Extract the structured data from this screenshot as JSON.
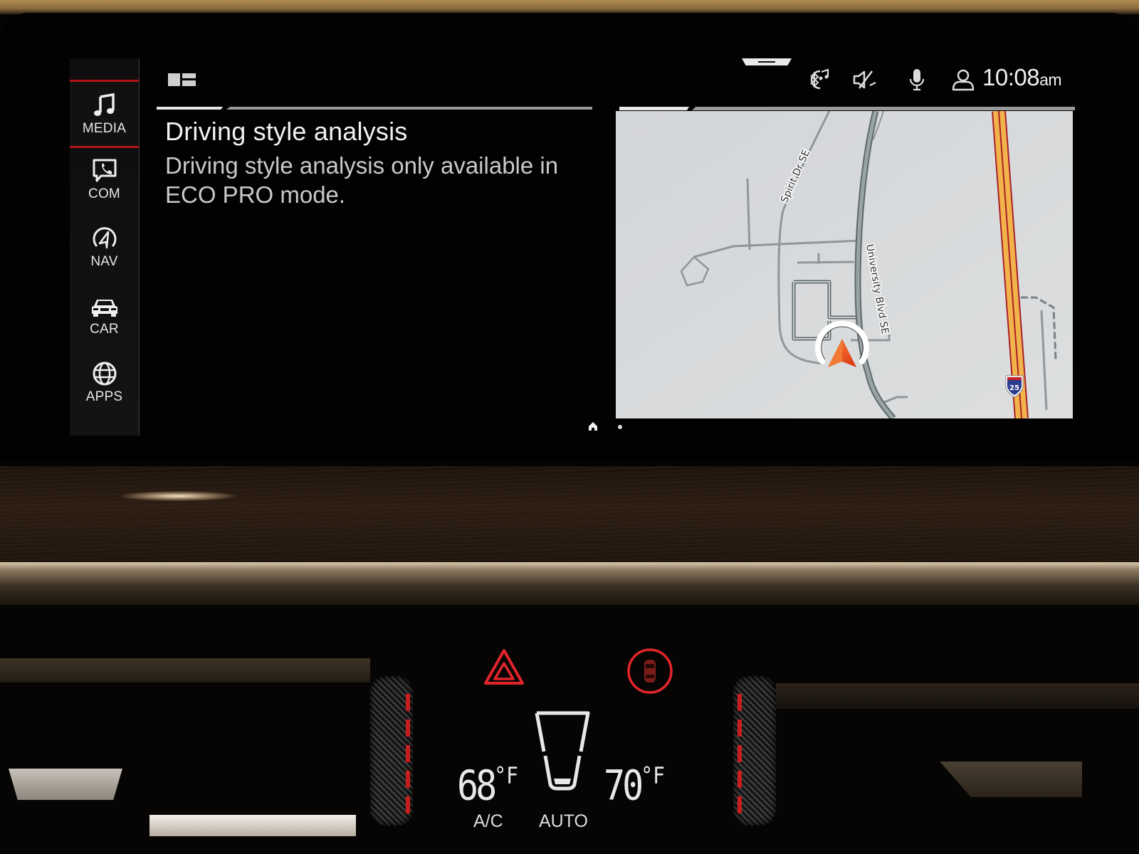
{
  "sidebar": {
    "items": [
      {
        "id": "media",
        "label": "MEDIA",
        "icon": "music-note-icon",
        "active": true
      },
      {
        "id": "com",
        "label": "COM",
        "icon": "phone-message-icon",
        "active": false
      },
      {
        "id": "nav",
        "label": "NAV",
        "icon": "navigation-icon",
        "active": false
      },
      {
        "id": "car",
        "label": "CAR",
        "icon": "car-icon",
        "active": false
      },
      {
        "id": "apps",
        "label": "APPS",
        "icon": "globe-icon",
        "active": false
      }
    ],
    "active_color": "#b3141a"
  },
  "status_bar": {
    "icons": [
      "bluetooth-audio-icon",
      "sound-muted-icon",
      "microphone-icon",
      "user-profile-icon"
    ],
    "time": "10:08",
    "ampm": "am"
  },
  "left_panel": {
    "title": "Driving style analysis",
    "message": "Driving style analysis only available in ECO PRO mode."
  },
  "map": {
    "street_labels": [
      "Spirit Dr SE",
      "University Blvd SE"
    ],
    "highway_shield": "25",
    "highway_colors": {
      "fill": "#f2b34b",
      "border": "#a8202a"
    },
    "vehicle_marker_color": "#f05a1e"
  },
  "pagination": {
    "pages": 2,
    "current": 1
  },
  "climate": {
    "left_temp": "68",
    "right_temp": "70",
    "unit": "°F",
    "ac_label": "A/C",
    "auto_label": "AUTO",
    "indicator_color": "#e3252b"
  }
}
